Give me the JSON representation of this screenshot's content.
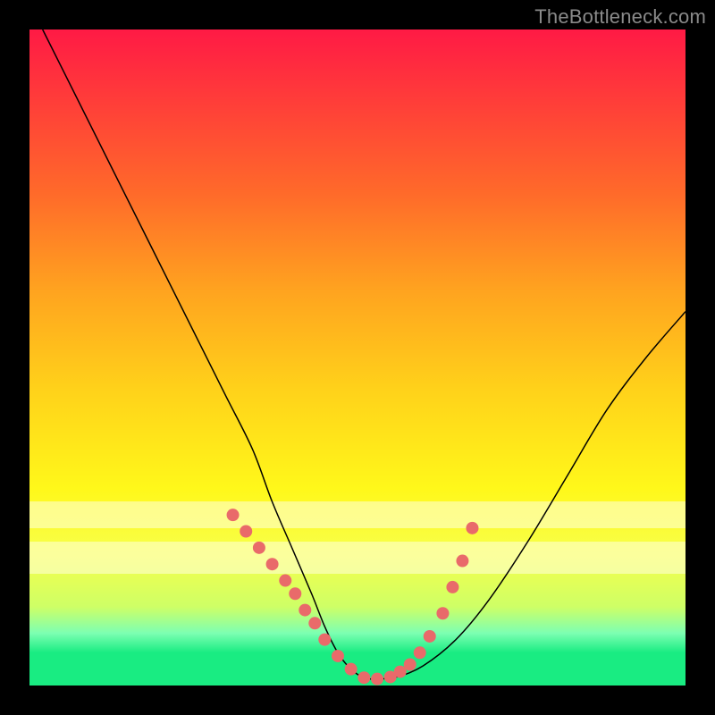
{
  "watermark": "TheBottleneck.com",
  "chart_data": {
    "type": "line",
    "title": "",
    "xlabel": "",
    "ylabel": "",
    "xlim": [
      0,
      100
    ],
    "ylim": [
      0,
      100
    ],
    "series": [
      {
        "name": "curve",
        "x": [
          2,
          6,
          10,
          14,
          18,
          22,
          26,
          30,
          34,
          37,
          40,
          43,
          45,
          47,
          49,
          51,
          53,
          56,
          60,
          65,
          70,
          76,
          82,
          88,
          94,
          100
        ],
        "y": [
          100,
          92,
          84,
          76,
          68,
          60,
          52,
          44,
          36,
          28,
          21,
          14,
          9,
          5,
          2.5,
          1.2,
          1,
          1.3,
          3,
          7,
          13,
          22,
          32,
          42,
          50,
          57
        ]
      }
    ],
    "markers": {
      "name": "dots",
      "color": "#e96a6a",
      "x": [
        31,
        33,
        35,
        37,
        39,
        40.5,
        42,
        43.5,
        45,
        47,
        49,
        51,
        53,
        55,
        56.5,
        58,
        59.5,
        61,
        63,
        64.5,
        66,
        67.5
      ],
      "y": [
        26,
        23.5,
        21,
        18.5,
        16,
        14,
        11.5,
        9.5,
        7,
        4.5,
        2.5,
        1.2,
        1.0,
        1.3,
        2.1,
        3.2,
        5,
        7.5,
        11,
        15,
        19,
        24
      ]
    },
    "bands": [
      {
        "y0": 17,
        "y1": 22,
        "color": "#ffffe0",
        "opacity": 0.55
      },
      {
        "y0": 24,
        "y1": 28,
        "color": "#ffffe0",
        "opacity": 0.55
      }
    ]
  }
}
